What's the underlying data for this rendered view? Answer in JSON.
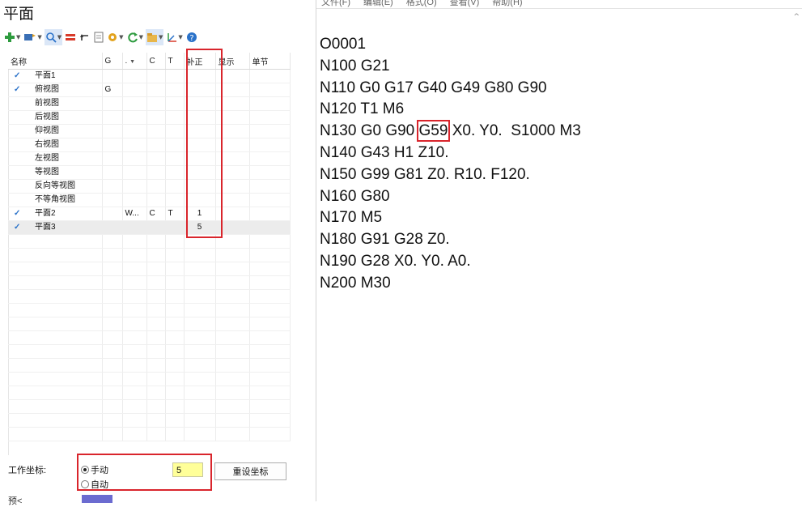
{
  "left_panel": {
    "title": "平面",
    "toolbar": {
      "icons": [
        "add-icon",
        "flag-icon",
        "search-icon",
        "equals-icon",
        "undo-arrow-icon",
        "document-icon",
        "gear-icon",
        "refresh-icon",
        "folder-icon",
        "axis-icon",
        "help-icon"
      ]
    },
    "grid": {
      "columns": [
        "名称",
        "G",
        ".",
        "C",
        "T",
        "补正",
        "显示",
        "单节"
      ],
      "rows": [
        {
          "checked": true,
          "name": "平面1",
          "g": "",
          "dot": "",
          "c": "",
          "t": "",
          "offset": ""
        },
        {
          "checked": true,
          "name": "俯视图",
          "g": "G",
          "dot": "",
          "c": "",
          "t": "",
          "offset": ""
        },
        {
          "checked": false,
          "name": "前视图",
          "g": "",
          "dot": "",
          "c": "",
          "t": "",
          "offset": ""
        },
        {
          "checked": false,
          "name": "后视图",
          "g": "",
          "dot": "",
          "c": "",
          "t": "",
          "offset": ""
        },
        {
          "checked": false,
          "name": "仰视图",
          "g": "",
          "dot": "",
          "c": "",
          "t": "",
          "offset": ""
        },
        {
          "checked": false,
          "name": "右视图",
          "g": "",
          "dot": "",
          "c": "",
          "t": "",
          "offset": ""
        },
        {
          "checked": false,
          "name": "左视图",
          "g": "",
          "dot": "",
          "c": "",
          "t": "",
          "offset": ""
        },
        {
          "checked": false,
          "name": "等视图",
          "g": "",
          "dot": "",
          "c": "",
          "t": "",
          "offset": ""
        },
        {
          "checked": false,
          "name": "反向等视图",
          "g": "",
          "dot": "",
          "c": "",
          "t": "",
          "offset": ""
        },
        {
          "checked": false,
          "name": "不等角视图",
          "g": "",
          "dot": "",
          "c": "",
          "t": "",
          "offset": ""
        },
        {
          "checked": true,
          "name": "平面2",
          "g": "",
          "dot": "W...",
          "c": "C",
          "t": "T",
          "offset": "1"
        },
        {
          "checked": true,
          "name": "平面3",
          "g": "",
          "dot": "",
          "c": "",
          "t": "",
          "offset": "5"
        }
      ],
      "check_glyph": "✓"
    },
    "work_coord": {
      "label": "工作坐标:",
      "manual_label": "手动",
      "auto_label": "自动",
      "selected": "manual",
      "value": "5",
      "reset_button": "重设坐标"
    },
    "bottom_label": "预<"
  },
  "editor": {
    "menu": [
      "文件(F)",
      "编辑(E)",
      "格式(O)",
      "查看(V)",
      "帮助(H)"
    ],
    "lines": [
      "O0001",
      "N100 G21",
      "N110 G0 G17 G40 G49 G80 G90",
      "N120 T1 M6",
      "N130 G0 G90 G59 X0. Y0.  S1000 M3",
      "N140 G43 H1 Z10.",
      "N150 G99 G81 Z0. R10. F120.",
      "N160 G80",
      "N170 M5",
      "N180 G91 G28 Z0.",
      "N190 G28 X0. Y0. A0.",
      "N200 M30"
    ],
    "highlight_line_parts": {
      "before": "N130 G0 G90 ",
      "highlight": "G59",
      "after": " X0. Y0.  S1000 M3"
    }
  },
  "colors": {
    "highlight_red": "#d9252c",
    "check_blue": "#2a72c9",
    "value_yellow": "#ffff99"
  }
}
